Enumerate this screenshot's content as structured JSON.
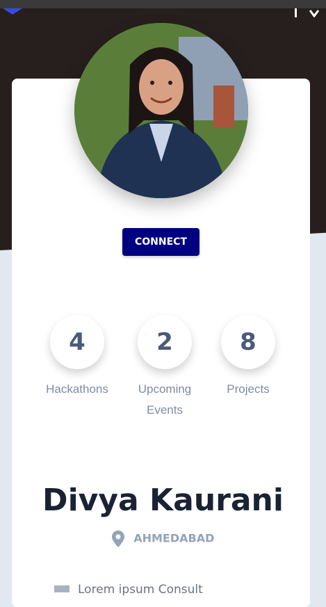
{
  "profile": {
    "name": "Divya Kaurani",
    "location": "AHMEDABAD",
    "connect_label": "CONNECT"
  },
  "stats": [
    {
      "value": "4",
      "label": "Hackathons"
    },
    {
      "value": "2",
      "label": "Upcoming",
      "label2": "Events"
    },
    {
      "value": "8",
      "label": "Projects"
    }
  ],
  "footer_partial_text": "Lorem ipsum Consult",
  "icons": {
    "logo": "triangle-logo-icon",
    "menu": "menu-bar-icon",
    "chevron": "chevron-down-icon",
    "location": "map-pin-icon",
    "avatar": "profile-photo"
  },
  "colors": {
    "hero_bg": "#261f1e",
    "page_bg": "#e2e8f0",
    "button_bg": "#000080",
    "name_text": "#1a2234",
    "stat_value": "#4a5a7a",
    "muted": "#94a3b8"
  }
}
